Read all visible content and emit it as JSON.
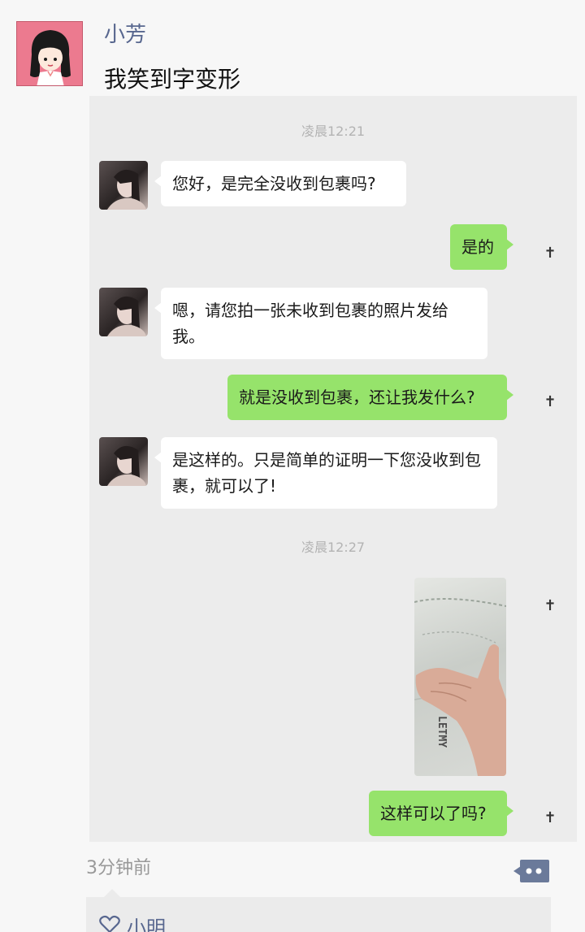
{
  "post": {
    "author": "小芳",
    "text": "我笑到字变形",
    "time": "3分钟前",
    "likes": [
      "小明"
    ]
  },
  "chat": {
    "times": [
      "凌晨12:21",
      "凌晨12:27"
    ],
    "messages": [
      {
        "side": "left",
        "text": "您好，是完全没收到包裹吗?"
      },
      {
        "side": "right",
        "text": "是的"
      },
      {
        "side": "left",
        "text": "嗯，请您拍一张未收到包裹的照片发给我。"
      },
      {
        "side": "right",
        "text": "就是没收到包裹，还让我发什么?"
      },
      {
        "side": "left",
        "text": "是这样的。只是简单的证明一下您没收到包裹，就可以了!"
      },
      {
        "side": "right",
        "type": "image",
        "image_text": "LETMY"
      },
      {
        "side": "right",
        "text": "这样可以了吗?"
      }
    ],
    "status_symbol": "✝"
  },
  "icons": {
    "avatar": "cartoon-girl-avatar",
    "comment": "comment-dots-icon",
    "like": "heart-icon"
  },
  "colors": {
    "author_name": "#58678f",
    "right_bubble": "#96e36b",
    "avatar_bg": "#ec7a8f"
  }
}
